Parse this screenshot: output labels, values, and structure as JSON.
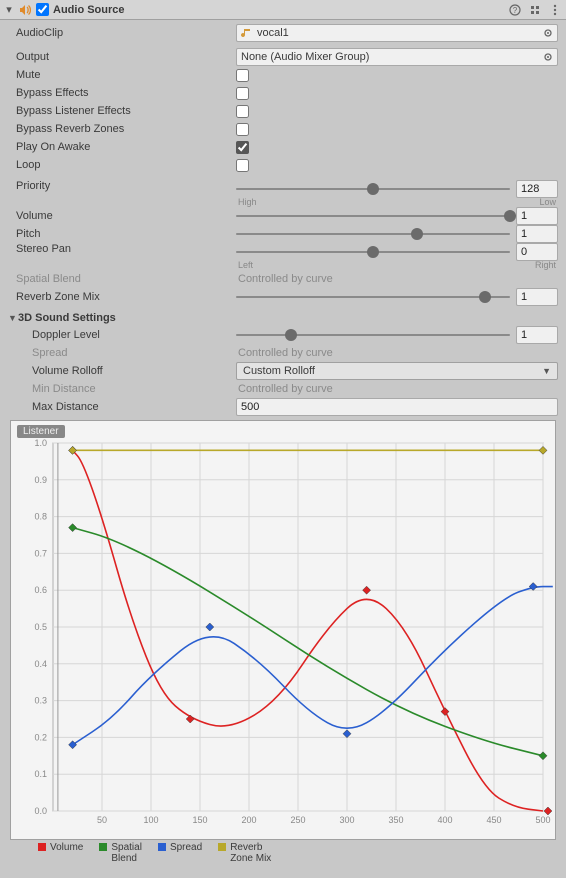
{
  "header": {
    "title": "Audio Source",
    "enabled": true
  },
  "fields": {
    "audioClip_label": "AudioClip",
    "audioClip_value": "vocal1",
    "output_label": "Output",
    "output_value": "None (Audio Mixer Group)",
    "mute_label": "Mute",
    "mute_value": false,
    "bypassEffects_label": "Bypass Effects",
    "bypassEffects_value": false,
    "bypassListener_label": "Bypass Listener Effects",
    "bypassListener_value": false,
    "bypassReverb_label": "Bypass Reverb Zones",
    "bypassReverb_value": false,
    "playOnAwake_label": "Play On Awake",
    "playOnAwake_value": true,
    "loop_label": "Loop",
    "loop_value": false,
    "priority_label": "Priority",
    "priority_value": "128",
    "priority_low": "High",
    "priority_high": "Low",
    "volume_label": "Volume",
    "volume_value": "1",
    "pitch_label": "Pitch",
    "pitch_value": "1",
    "stereoPan_label": "Stereo Pan",
    "stereoPan_value": "0",
    "stereoPan_left": "Left",
    "stereoPan_right": "Right",
    "spatialBlend_label": "Spatial Blend",
    "spatialBlend_controlled": "Controlled by curve",
    "reverbZoneMix_label": "Reverb Zone Mix",
    "reverbZoneMix_value": "1"
  },
  "threeD": {
    "title": "3D Sound Settings",
    "doppler_label": "Doppler Level",
    "doppler_value": "1",
    "spread_label": "Spread",
    "spread_controlled": "Controlled by curve",
    "rolloff_label": "Volume Rolloff",
    "rolloff_value": "Custom Rolloff",
    "minDist_label": "Min Distance",
    "minDist_controlled": "Controlled by curve",
    "maxDist_label": "Max Distance",
    "maxDist_value": "500"
  },
  "graph": {
    "listener_chip": "Listener",
    "legend": {
      "volume": "Volume",
      "spatial": "Spatial\nBlend",
      "spread": "Spread",
      "reverb": "Reverb\nZone Mix"
    }
  },
  "chart_data": {
    "type": "line",
    "xlabel": "",
    "ylabel": "",
    "xlim": [
      0,
      500
    ],
    "ylim": [
      0,
      1.0
    ],
    "x_ticks": [
      50,
      100,
      150,
      200,
      250,
      300,
      350,
      400,
      450,
      500
    ],
    "y_ticks": [
      0.0,
      0.1,
      0.2,
      0.3,
      0.4,
      0.5,
      0.6,
      0.7,
      0.8,
      0.9,
      1.0
    ],
    "series": [
      {
        "name": "Volume",
        "color": "#d22",
        "keys_x": [
          20,
          140,
          320,
          400,
          505
        ],
        "keys_y": [
          0.98,
          0.25,
          0.6,
          0.27,
          0.0
        ],
        "points_x": [
          20,
          30,
          50,
          80,
          110,
          140,
          180,
          230,
          280,
          320,
          360,
          400,
          440,
          470,
          500
        ],
        "points_y": [
          0.98,
          0.95,
          0.8,
          0.52,
          0.32,
          0.25,
          0.22,
          0.3,
          0.5,
          0.6,
          0.5,
          0.27,
          0.06,
          0.01,
          0.0
        ]
      },
      {
        "name": "Spatial Blend",
        "color": "#2a8a2a",
        "keys_x": [
          20,
          500
        ],
        "keys_y": [
          0.77,
          0.15
        ],
        "points_x": [
          20,
          60,
          120,
          200,
          280,
          360,
          440,
          500
        ],
        "points_y": [
          0.77,
          0.74,
          0.66,
          0.53,
          0.39,
          0.27,
          0.19,
          0.15
        ]
      },
      {
        "name": "Spread",
        "color": "#2a5fd0",
        "keys_x": [
          20,
          160,
          300,
          490
        ],
        "keys_y": [
          0.18,
          0.5,
          0.21,
          0.61
        ],
        "points_x": [
          20,
          60,
          100,
          160,
          210,
          260,
          300,
          340,
          400,
          460,
          490,
          510
        ],
        "points_y": [
          0.18,
          0.25,
          0.37,
          0.5,
          0.41,
          0.27,
          0.21,
          0.27,
          0.44,
          0.58,
          0.61,
          0.61
        ]
      },
      {
        "name": "Reverb Zone Mix",
        "color": "#b8a82a",
        "keys_x": [
          20,
          500
        ],
        "keys_y": [
          0.98,
          0.98
        ],
        "points_x": [
          20,
          500
        ],
        "points_y": [
          0.98,
          0.98
        ]
      }
    ]
  }
}
